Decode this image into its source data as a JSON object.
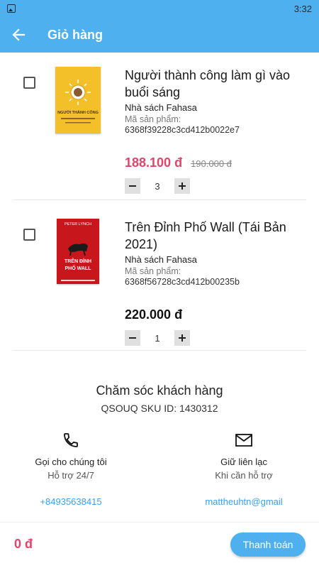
{
  "status_bar": {
    "time": "3:32"
  },
  "app_bar": {
    "title": "Giỏ hàng"
  },
  "cart": {
    "items": [
      {
        "title": "Người thành công làm gì vào buổi sáng",
        "seller": "Nhà sách Fahasa",
        "sku_label": "Mã sản phẩm:",
        "sku": "6368f39228c3cd412b0022e7",
        "price": "188.100 đ",
        "old_price": "190.000 đ",
        "quantity": "3",
        "cover_title": "NGƯỜI THÀNH CÔNG"
      },
      {
        "title": "Trên Đỉnh Phố Wall (Tái Bản 2021)",
        "seller": "Nhà sách Fahasa",
        "sku_label": "Mã sản phẩm:",
        "sku": "6368f56728c3cd412b00235b",
        "price": "220.000 đ",
        "quantity": "1",
        "cover_author": "PETER LYNCH",
        "cover_title_1": "TRÊN ĐỈNH",
        "cover_title_2": "PHỐ WALL"
      }
    ]
  },
  "support": {
    "title": "Chăm sóc khách hàng",
    "sku_text": "QSOUQ SKU ID: 1430312",
    "call": {
      "label": "Gọi cho chúng tôi",
      "sub": "Hỗ trợ 24/7",
      "link": "+84935638415",
      "icon": "phone-icon"
    },
    "mail": {
      "label": "Giữ liên lạc",
      "sub": "Khi cần hỗ trợ",
      "link": "mattheuhtn@gmail",
      "icon": "mail-icon"
    }
  },
  "footer": {
    "total": "0 đ",
    "pay_label": "Thanh toán"
  },
  "colors": {
    "primary": "#4eb0ef",
    "price": "#e8426a",
    "link": "#3a9ff0"
  }
}
